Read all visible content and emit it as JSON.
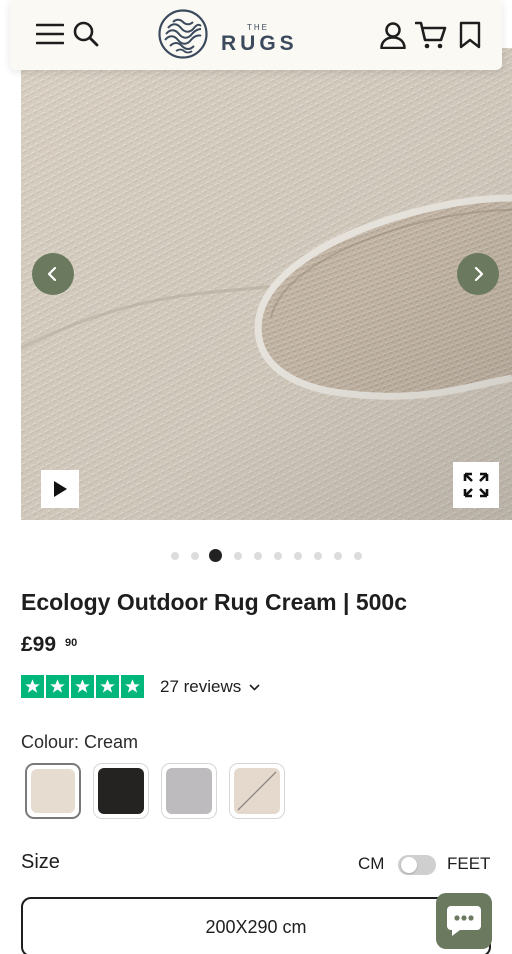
{
  "header": {
    "logo_small": "THE",
    "logo_word": "RUGS",
    "icons": [
      "menu-icon",
      "search-icon",
      "account-icon",
      "cart-icon",
      "wishlist-icon"
    ]
  },
  "gallery": {
    "image_count": 10,
    "active_index": 2,
    "icons": [
      "chevron-left-icon",
      "chevron-right-icon",
      "play-icon",
      "expand-icon"
    ]
  },
  "product": {
    "title": "Ecology Outdoor Rug Cream | 500c",
    "price_main": "£99",
    "price_cents": "90",
    "rating_stars": 5,
    "reviews": "27 reviews"
  },
  "colour": {
    "label": "Colour: Cream",
    "selected_index": 0,
    "swatches": [
      {
        "name": "Cream",
        "color": "#e6ddd0"
      },
      {
        "name": "Black",
        "color": "#242322"
      },
      {
        "name": "Grey",
        "color": "#bdbbbd"
      },
      {
        "name": "Beige",
        "color": "#e5d8cd"
      }
    ]
  },
  "size": {
    "label": "Size",
    "unit_left": "CM",
    "unit_right": "FEET",
    "option": "200X290 cm"
  },
  "colors": {
    "accent": "#6b7a5e",
    "trustpilot": "#00b67a",
    "header_bg": "#faf9f4"
  }
}
